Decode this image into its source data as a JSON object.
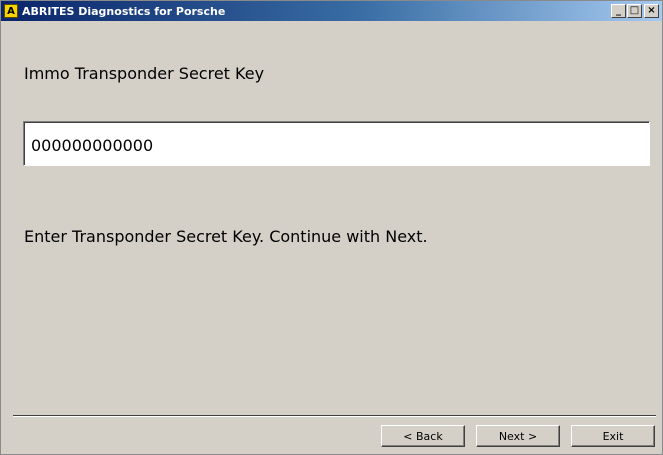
{
  "window": {
    "title": "ABRITES Diagnostics for Porsche",
    "app_icon_letter": "A",
    "minimize_glyph": "_",
    "maximize_glyph": "□",
    "close_glyph": "×"
  },
  "form": {
    "heading": "Immo Transponder Secret Key",
    "key_value": "000000000000",
    "hint": "Enter Transponder Secret Key. Continue with Next."
  },
  "buttons": {
    "back_label": "< Back",
    "next_label": "Next >",
    "exit_label": "Exit"
  },
  "colors": {
    "titlebar_start": "#0a246a",
    "titlebar_end": "#a6caf0",
    "background": "#d4d0c8",
    "app_icon": "#f5d400"
  }
}
